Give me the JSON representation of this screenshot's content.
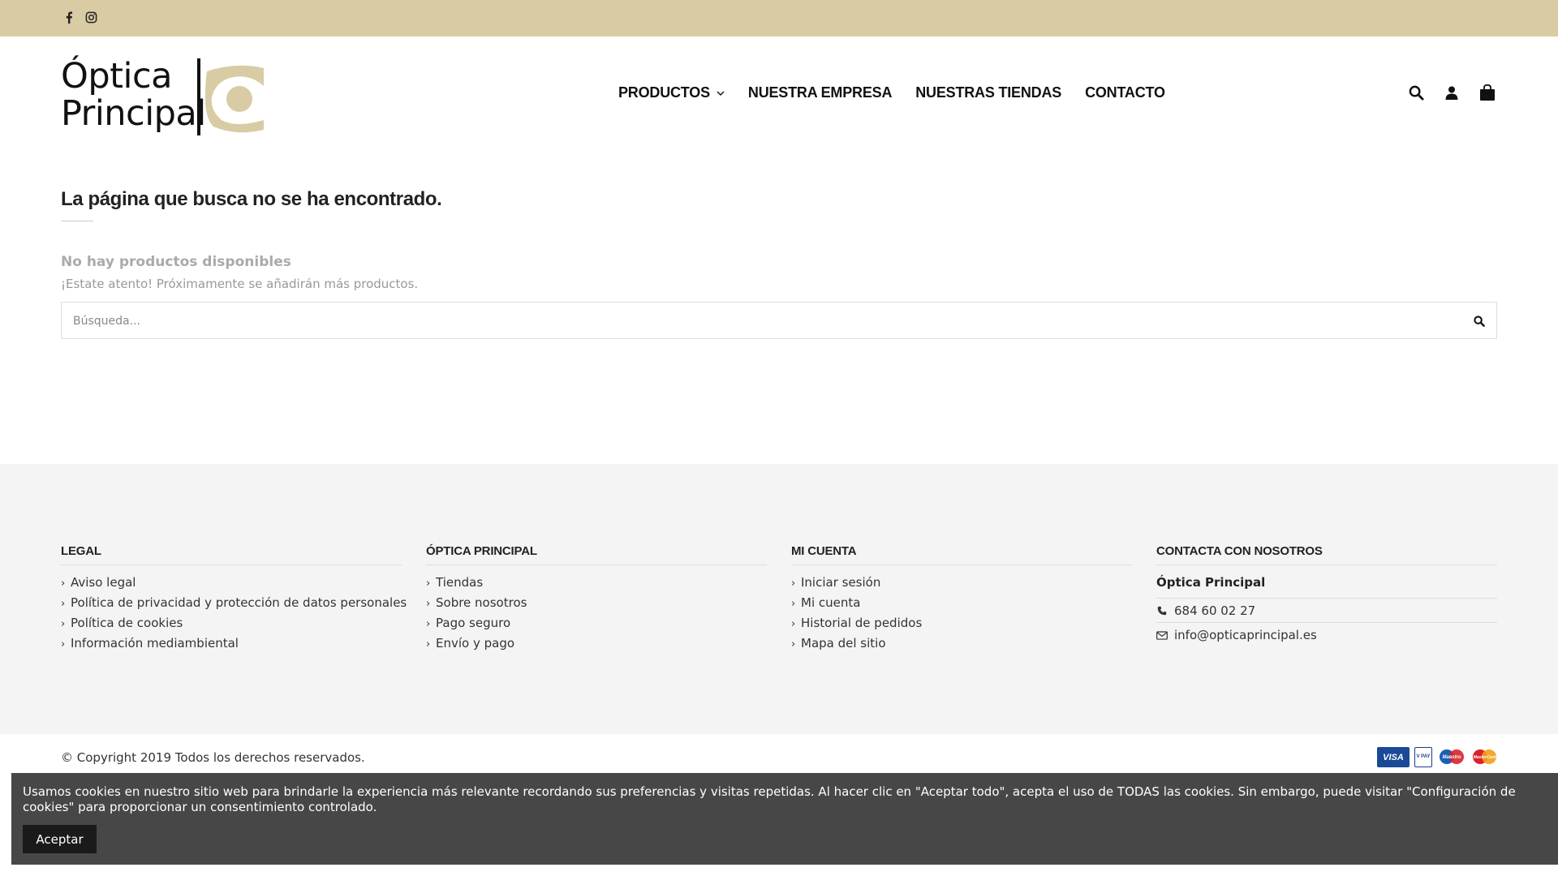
{
  "topbar": {
    "social": [
      {
        "icon": "facebook-icon"
      },
      {
        "icon": "instagram-icon"
      }
    ],
    "background_color": "#d9cba4"
  },
  "header": {
    "logo": {
      "line1": "Óptica",
      "line2": "Principal",
      "accent_color": "#d9cba4"
    },
    "nav": [
      {
        "label": "PRODUCTOS",
        "has_dropdown": true
      },
      {
        "label": "NUESTRA EMPRESA"
      },
      {
        "label": "NUESTRAS TIENDAS"
      },
      {
        "label": "CONTACTO"
      }
    ],
    "icons": [
      "search-icon",
      "user-icon",
      "shopping-bag-icon"
    ]
  },
  "main": {
    "title": "La página que busca no se ha encontrado.",
    "no_products_title": "No hay productos disponibles",
    "no_products_subtitle": "¡Estate atento! Próximamente se añadirán más productos.",
    "search_placeholder": "Búsqueda..."
  },
  "footer": {
    "columns": [
      {
        "title": "LEGAL",
        "links": [
          "Aviso legal",
          "Política de privacidad y protección de datos personales",
          "Política de cookies",
          "Información mediambiental"
        ]
      },
      {
        "title": "ÓPTICA PRINCIPAL",
        "links": [
          "Tiendas",
          "Sobre nosotros",
          "Pago seguro",
          "Envío y pago"
        ]
      },
      {
        "title": "MI CUENTA",
        "links": [
          "Iniciar sesión",
          "Mi cuenta",
          "Historial de pedidos",
          "Mapa del sitio"
        ]
      }
    ],
    "contact": {
      "title": "CONTACTA CON NOSOTROS",
      "name": "Óptica Principal",
      "phone": "684 60 02 27",
      "email": "info@opticaprincipal.es"
    },
    "copyright": "© Copyright 2019 Todos los derechos reservados.",
    "payment_methods": [
      {
        "label": "VISA",
        "color": "#1a4a97"
      },
      {
        "label": "V PAY",
        "color": "#1a3c8f"
      },
      {
        "label": "Maestro",
        "color": "#1b5fb5"
      },
      {
        "label": "MasterCard",
        "color": "#e56a12"
      }
    ]
  },
  "cookie_banner": {
    "text": "Usamos cookies en nuestro sitio web para brindarle la experiencia más relevante recordando sus preferencias y visitas repetidas. Al hacer clic en \"Aceptar todo\", acepta el uso de TODAS las cookies. Sin embargo, puede visitar \"Configuración de cookies\" para proporcionar un consentimiento controlado.",
    "accept_label": "Aceptar"
  }
}
